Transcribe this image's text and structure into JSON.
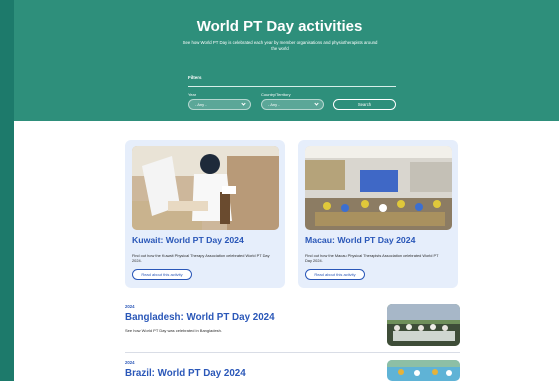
{
  "hero": {
    "title": "World PT Day activities",
    "subtitle": "See how World PT Day is celebrated each year by member organisations and physiotherapists around the world",
    "background": "#2e8f7b"
  },
  "filters": {
    "heading": "Filters",
    "year_label": "Year",
    "year_value": "- Any -",
    "country_label": "Country/Territory",
    "country_value": "- Any -",
    "search_label": "Search"
  },
  "cards": [
    {
      "title": "Kuwait: World PT Day 2024",
      "description": "Find out how the Kuwait Physical Therapy Association celebrated World PT Day 2024.",
      "button": "Read about this activity"
    },
    {
      "title": "Macau: World PT Day 2024",
      "description": "Find out how the Macau Physical Therapists Association celebrated World PT Day 2024.",
      "button": "Read about this activity"
    }
  ],
  "list": [
    {
      "year": "2024",
      "title": "Bangladesh: World PT Day 2024",
      "description": "See how World PT Day was celebrated in Bangladesh."
    },
    {
      "year": "2024",
      "title": "Brazil: World PT Day 2024"
    }
  ],
  "colors": {
    "accent": "#2a57b8",
    "card_bg": "#e6eefb",
    "side_bar": "#1d7a6b"
  }
}
